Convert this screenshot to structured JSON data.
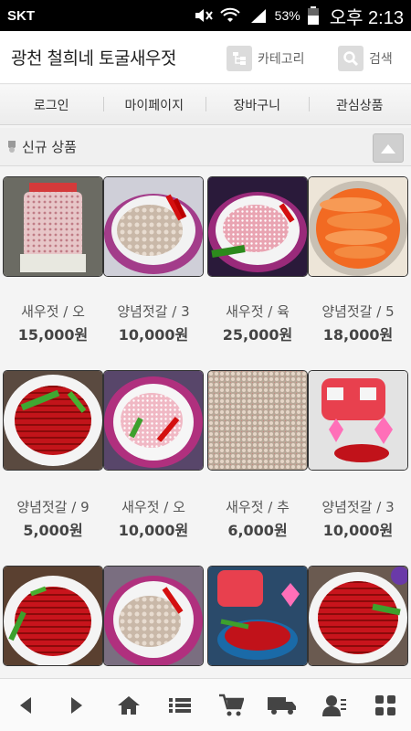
{
  "status": {
    "carrier": "SKT",
    "battery": "53%",
    "time": "오후 2:13"
  },
  "header": {
    "title": "광천 철희네 토굴새우젓",
    "category_label": "카테고리",
    "search_label": "검색"
  },
  "menu": [
    "로그인",
    "마이페이지",
    "장바구니",
    "관심상품"
  ],
  "section": {
    "title": "신규 상품"
  },
  "products": [
    {
      "name": "새우젓 / 오",
      "price": "15,000원"
    },
    {
      "name": "양념젓갈 / 3",
      "price": "10,000원"
    },
    {
      "name": "새우젓 / 육",
      "price": "25,000원"
    },
    {
      "name": "양념젓갈 / 5",
      "price": "18,000원"
    },
    {
      "name": "양념젓갈 / 9",
      "price": "5,000원"
    },
    {
      "name": "새우젓 / 오",
      "price": "10,000원"
    },
    {
      "name": "새우젓 / 추",
      "price": "6,000원"
    },
    {
      "name": "양념젓갈 / 3",
      "price": "10,000원"
    },
    {
      "name": "",
      "price": ""
    },
    {
      "name": "",
      "price": ""
    },
    {
      "name": "",
      "price": ""
    },
    {
      "name": "",
      "price": ""
    }
  ],
  "bottom_nav": [
    "back-icon",
    "forward-icon",
    "home-icon",
    "list-icon",
    "cart-icon",
    "delivery-icon",
    "member-icon",
    "grid-icon"
  ]
}
